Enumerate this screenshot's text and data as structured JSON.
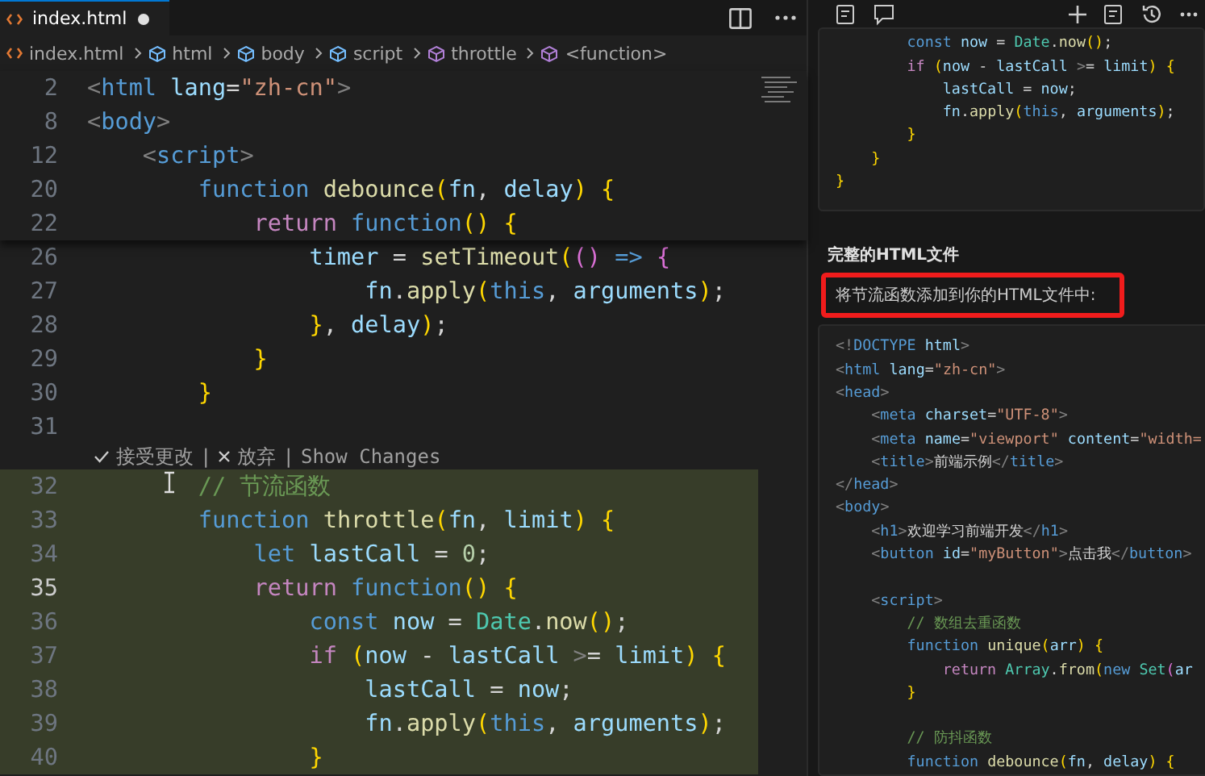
{
  "tabs": [
    {
      "label": "index.html",
      "selected": true,
      "modified": true
    }
  ],
  "breadcrumb": [
    {
      "label": "index.html",
      "kind": "file"
    },
    {
      "label": "html",
      "kind": "element"
    },
    {
      "label": "body",
      "kind": "element"
    },
    {
      "label": "script",
      "kind": "element"
    },
    {
      "label": "throttle",
      "kind": "function"
    },
    {
      "label": "<function>",
      "kind": "function"
    }
  ],
  "editor": {
    "sticky_lines": [
      {
        "number": "2",
        "text": "<html lang=\"zh-cn\">"
      },
      {
        "number": "8",
        "text": "<body>"
      },
      {
        "number": "12",
        "text": "    <script>"
      },
      {
        "number": "20",
        "text": "        function debounce(fn, delay) {"
      },
      {
        "number": "22",
        "text": "            return function() {"
      }
    ],
    "lines": [
      {
        "kind": "code",
        "number": "26",
        "added": false,
        "current": false,
        "text": "                timer = setTimeout(() => {"
      },
      {
        "kind": "code",
        "number": "27",
        "added": false,
        "current": false,
        "text": "                    fn.apply(this, arguments);"
      },
      {
        "kind": "code",
        "number": "28",
        "added": false,
        "current": false,
        "text": "                }, delay);"
      },
      {
        "kind": "code",
        "number": "29",
        "added": false,
        "current": false,
        "text": "            }"
      },
      {
        "kind": "code",
        "number": "30",
        "added": false,
        "current": false,
        "text": "        }"
      },
      {
        "kind": "code",
        "number": "31",
        "added": false,
        "current": false
      },
      {
        "kind": "codelens",
        "actions": [
          "接受更改",
          "放弃",
          "Show Changes"
        ],
        "separator": "|"
      },
      {
        "kind": "code",
        "number": "32",
        "added": true,
        "current": false,
        "text": "        // 节流函数"
      },
      {
        "kind": "code",
        "number": "33",
        "added": true,
        "current": false,
        "text": "        function throttle(fn, limit) {"
      },
      {
        "kind": "code",
        "number": "34",
        "added": true,
        "current": false,
        "text": "            let lastCall = 0;"
      },
      {
        "kind": "code",
        "number": "35",
        "added": true,
        "current": true,
        "text": "            return function() {"
      },
      {
        "kind": "code",
        "number": "36",
        "added": true,
        "current": false,
        "text": "                const now = Date.now();"
      },
      {
        "kind": "code",
        "number": "37",
        "added": true,
        "current": false,
        "text": "                if (now - lastCall >= limit) {"
      },
      {
        "kind": "code",
        "number": "38",
        "added": true,
        "current": false,
        "text": "                    lastCall = now;"
      },
      {
        "kind": "code",
        "number": "39",
        "added": true,
        "current": false,
        "text": "                    fn.apply(this, arguments);"
      },
      {
        "kind": "code",
        "number": "40",
        "added": true,
        "current": false,
        "text": "                }"
      }
    ]
  },
  "chat": {
    "code_block_1": [
      "        const now = Date.now();",
      "        if (now - lastCall >= limit) {",
      "            lastCall = now;",
      "            fn.apply(this, arguments);",
      "        }",
      "    }",
      "}"
    ],
    "heading": "完整的HTML文件",
    "intro": "将节流函数添加到你的HTML文件中:",
    "code_block_2": [
      {
        "text": "<!DOCTYPE html>",
        "gap_before": false
      },
      {
        "text": "<html lang=\"zh-cn\">",
        "gap_before": false
      },
      {
        "text": "<head>",
        "gap_before": false
      },
      {
        "text": "    <meta charset=\"UTF-8\">",
        "gap_before": false
      },
      {
        "text": "    <meta name=\"viewport\" content=\"width=",
        "gap_before": false
      },
      {
        "text": "    <title>前端示例</title>",
        "gap_before": false
      },
      {
        "text": "</head>",
        "gap_before": false
      },
      {
        "text": "<body>",
        "gap_before": false
      },
      {
        "text": "    <h1>欢迎学习前端开发</h1>",
        "gap_before": false
      },
      {
        "text": "    <button id=\"myButton\">点击我</button>",
        "gap_before": false
      },
      {
        "text": "    <script>",
        "gap_before": true
      },
      {
        "text": "        // 数组去重函数",
        "gap_before": false
      },
      {
        "text": "        function unique(arr) {",
        "gap_before": false
      },
      {
        "text": "            return Array.from(new Set(ar",
        "gap_before": false
      },
      {
        "text": "        }",
        "gap_before": false
      },
      {
        "text": "        // 防抖函数",
        "gap_before": true
      },
      {
        "text": "        function debounce(fn, delay) {",
        "gap_before": false
      }
    ]
  }
}
